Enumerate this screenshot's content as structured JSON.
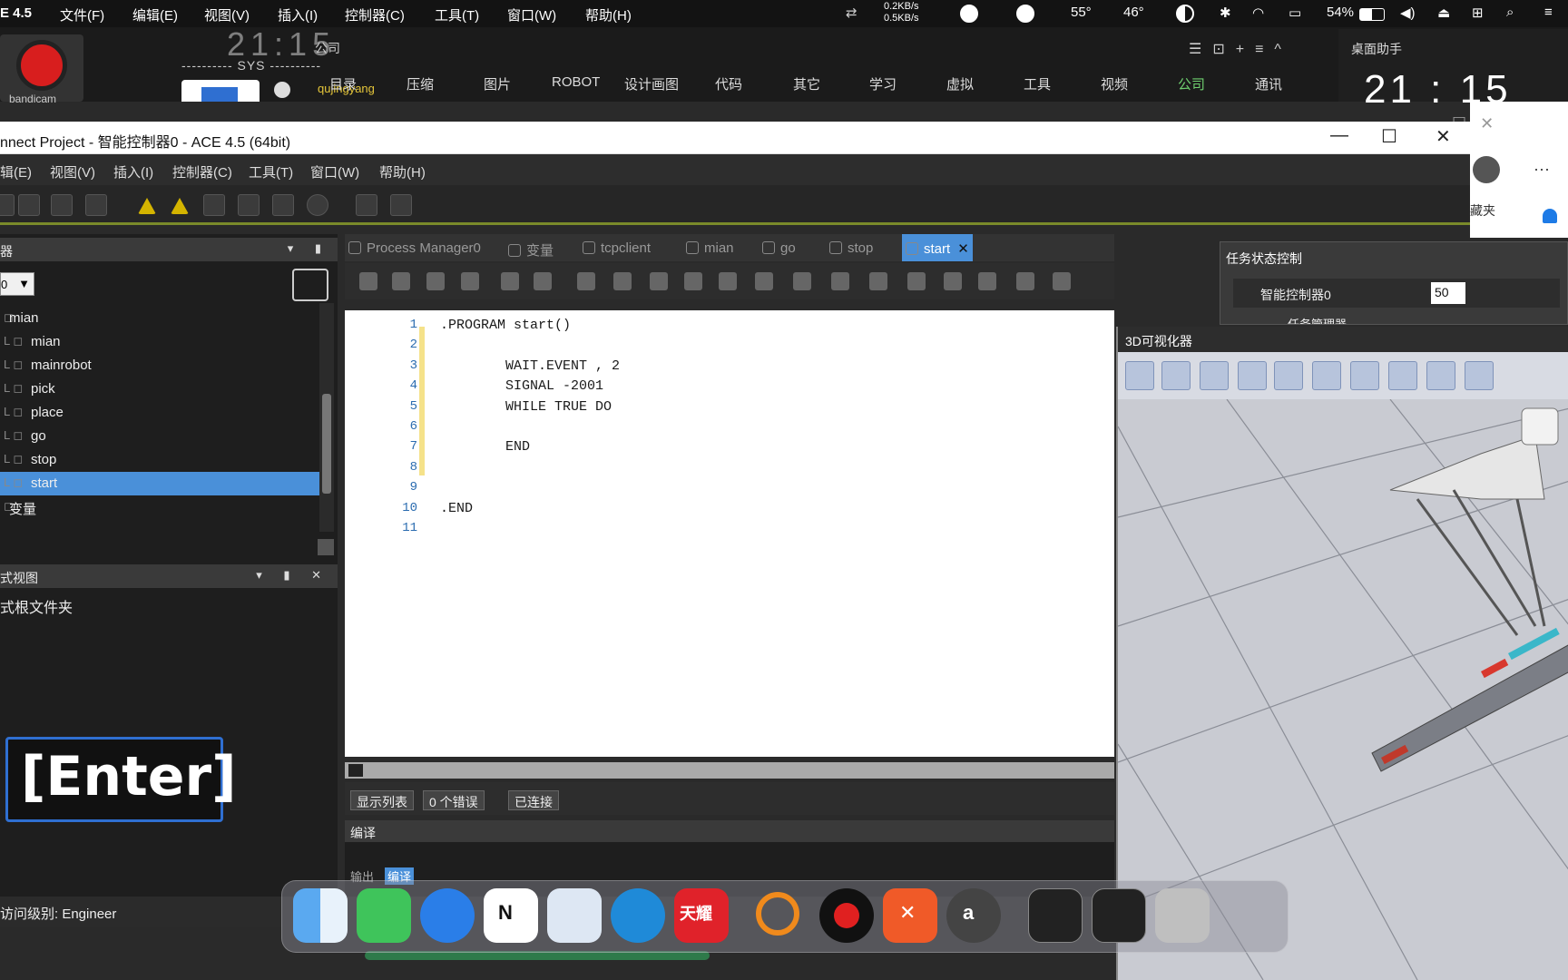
{
  "mac_menubar": {
    "app_name": "E 4.5",
    "menus": [
      "文件(F)",
      "编辑(E)",
      "视图(V)",
      "插入(I)",
      "控制器(C)",
      "工具(T)",
      "窗口(W)",
      "帮助(H)"
    ],
    "net_up": "0.2KB/s",
    "net_down": "0.5KB/s",
    "temp1": "55°",
    "temp2": "46°",
    "battery": "54%"
  },
  "bandicam_label": "bandicam",
  "bookmarks": {
    "company_label": "公司",
    "sys_line": "---------- SYS ----------",
    "user": "qujingyang",
    "nav": [
      "目录",
      "压缩",
      "图片",
      "ROBOT",
      "设计画图",
      "代码",
      "其它",
      "学习",
      "虚拟",
      "工具",
      "视频",
      "公司",
      "通讯"
    ]
  },
  "assistant": {
    "title": "桌面助手",
    "clock": "21 : 15"
  },
  "side_panel": {
    "label": "藏夹"
  },
  "window": {
    "title": "nnect Project - 智能控制器0 - ACE 4.5 (64bit)",
    "menus": [
      "辑(E)",
      "视图(V)",
      "插入(I)",
      "控制器(C)",
      "工具(T)",
      "窗口(W)",
      "帮助(H)"
    ]
  },
  "left_pane": {
    "top_header": "器",
    "combo_value": "0",
    "tree": [
      {
        "label": "mian",
        "indent": 0,
        "selected": false
      },
      {
        "label": "mian",
        "indent": 1,
        "selected": false
      },
      {
        "label": "mainrobot",
        "indent": 1,
        "selected": false
      },
      {
        "label": "pick",
        "indent": 1,
        "selected": false
      },
      {
        "label": "place",
        "indent": 1,
        "selected": false
      },
      {
        "label": "go",
        "indent": 1,
        "selected": false
      },
      {
        "label": "stop",
        "indent": 1,
        "selected": false
      },
      {
        "label": "start",
        "indent": 1,
        "selected": true
      },
      {
        "label": "变量",
        "indent": 0,
        "selected": false
      }
    ],
    "view_header": "式视图",
    "root_folder": "式根文件夹",
    "key_overlay": "[Enter]",
    "status": "访问级别: Engineer"
  },
  "editor": {
    "tabs": [
      {
        "label": "Process Manager0",
        "active": false
      },
      {
        "label": "变量",
        "active": false
      },
      {
        "label": "tcpclient",
        "active": false
      },
      {
        "label": "mian",
        "active": false
      },
      {
        "label": "go",
        "active": false
      },
      {
        "label": "stop",
        "active": false
      },
      {
        "label": "start",
        "active": true
      }
    ],
    "close_glyph": "✕",
    "lines": [
      ".PROGRAM start()",
      "",
      "        WAIT.EVENT , 2",
      "        SIGNAL -2001",
      "        WHILE TRUE DO",
      "",
      "        END",
      "",
      "",
      ".END",
      ""
    ],
    "status_buttons": [
      "显示列表",
      "0 个错误",
      "已连接"
    ],
    "compile_header": "编译",
    "compile_tabs": [
      "输出",
      "编译"
    ]
  },
  "task_control": {
    "title": "任务状态控制",
    "controller": "智能控制器0",
    "value": "50",
    "sub": "任务管理器"
  },
  "viz": {
    "title": "3D可视化器"
  },
  "colors": {
    "accent": "#4a90d9",
    "line_numbers": "#2b6cb0",
    "change_bar": "#f5e28a",
    "toolbar_border": "#7a8a2a"
  }
}
